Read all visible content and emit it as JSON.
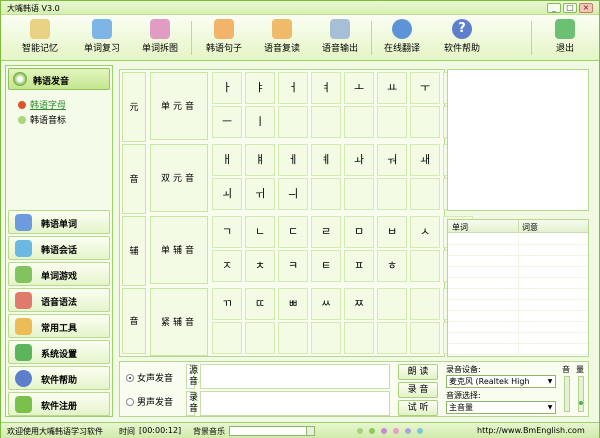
{
  "app": {
    "title": "大嘴韩语 V3.0"
  },
  "window_controls": {
    "minimize": "_",
    "maximize": "□",
    "close": "×"
  },
  "toolbar": {
    "items": [
      {
        "label": "智能记忆",
        "icon": "smart-memory-icon",
        "color": "#c9a94a"
      },
      {
        "label": "单词复习",
        "icon": "word-review-icon",
        "color": "#3a8bd0"
      },
      {
        "label": "单词拆图",
        "icon": "word-split-icon",
        "color": "#c2498e"
      },
      {
        "label": "韩语句子",
        "icon": "korean-sentence-icon",
        "color": "#e08a2c"
      },
      {
        "label": "语音复读",
        "icon": "voice-repeat-icon",
        "color": "#d98a22"
      },
      {
        "label": "语音输出",
        "icon": "voice-output-icon",
        "color": "#6a8bb0"
      },
      {
        "label": "在线翻译",
        "icon": "online-translate-icon",
        "color": "#2f6fc2"
      },
      {
        "label": "软件帮助",
        "icon": "help-icon",
        "color": "#3a62b8"
      },
      {
        "label": "退出",
        "icon": "exit-icon",
        "color": "#3aa64a"
      }
    ]
  },
  "sidebar": {
    "section_title": "韩语发音",
    "sub_items": [
      {
        "label": "韩语字母",
        "active": true
      },
      {
        "label": "韩语音标",
        "active": false
      }
    ],
    "items": [
      {
        "label": "韩语单词",
        "icon": "korean-word-icon",
        "color": "#4a7fcf"
      },
      {
        "label": "韩语会话",
        "icon": "conversation-icon",
        "color": "#3aa0d8"
      },
      {
        "label": "单词游戏",
        "icon": "word-game-icon",
        "color": "#5ab33a"
      },
      {
        "label": "语音语法",
        "icon": "grammar-icon",
        "color": "#d14c3b"
      },
      {
        "label": "常用工具",
        "icon": "tools-icon",
        "color": "#e2a322"
      },
      {
        "label": "系统设置",
        "icon": "settings-icon",
        "color": "#3aa53a"
      },
      {
        "label": "软件帮助",
        "icon": "help-icon",
        "color": "#3d5fc1"
      },
      {
        "label": "软件注册",
        "icon": "register-icon",
        "color": "#5cab2f"
      }
    ]
  },
  "alphabet": {
    "vowel_label": {
      "top": "元",
      "bottom": "音"
    },
    "consonant_label": {
      "top": "辅",
      "bottom": "音"
    },
    "groups": [
      {
        "label": "单元音",
        "letters": [
          "ㅏ",
          "ㅑ",
          "ㅓ",
          "ㅕ",
          "ㅗ",
          "ㅛ",
          "ㅜ",
          "ㅠ",
          "ㅡ",
          "ㅣ"
        ]
      },
      {
        "label": "双元音",
        "letters": [
          "ㅐ",
          "ㅒ",
          "ㅔ",
          "ㅖ",
          "ㅘ",
          "ㅝ",
          "ㅙ",
          "ㅞ",
          "ㅚ",
          "ㅟ",
          "ㅢ"
        ]
      },
      {
        "label": "单辅音",
        "letters": [
          "ㄱ",
          "ㄴ",
          "ㄷ",
          "ㄹ",
          "ㅁ",
          "ㅂ",
          "ㅅ",
          "ㅇ",
          "ㅈ",
          "ㅊ",
          "ㅋ",
          "ㅌ",
          "ㅍ",
          "ㅎ"
        ]
      },
      {
        "label": "紧辅音",
        "letters": [
          "ㄲ",
          "ㄸ",
          "ㅃ",
          "ㅆ",
          "ㅉ"
        ]
      }
    ]
  },
  "word_list": {
    "columns": [
      "单词",
      "词意"
    ],
    "rows": []
  },
  "bottom_panel": {
    "female_voice": "女声发音",
    "male_voice": "男声发音",
    "source_label": "源音",
    "record_label": "录音",
    "btn_read": "朗 读",
    "btn_record": "录 音",
    "btn_listen": "试 听",
    "record_device_label": "录音设备:",
    "record_device_value": "麦克风 (Realtek High",
    "source_select_label": "音源选择:",
    "source_select_value": "主音量",
    "volume_label_1": "音",
    "volume_label_2": "量"
  },
  "status": {
    "welcome": "欢迎使用大嘴韩语学习软件",
    "time_label": "时间",
    "time_value": "[00:00:12]",
    "bg_music_label": "背景音乐",
    "url": "http://www.BmEnglish.com",
    "color_dots": [
      "#a8d27a",
      "#8fc85c",
      "#c98bd2",
      "#e7a0c8",
      "#a9a9e0",
      "#7cc8d8"
    ]
  }
}
